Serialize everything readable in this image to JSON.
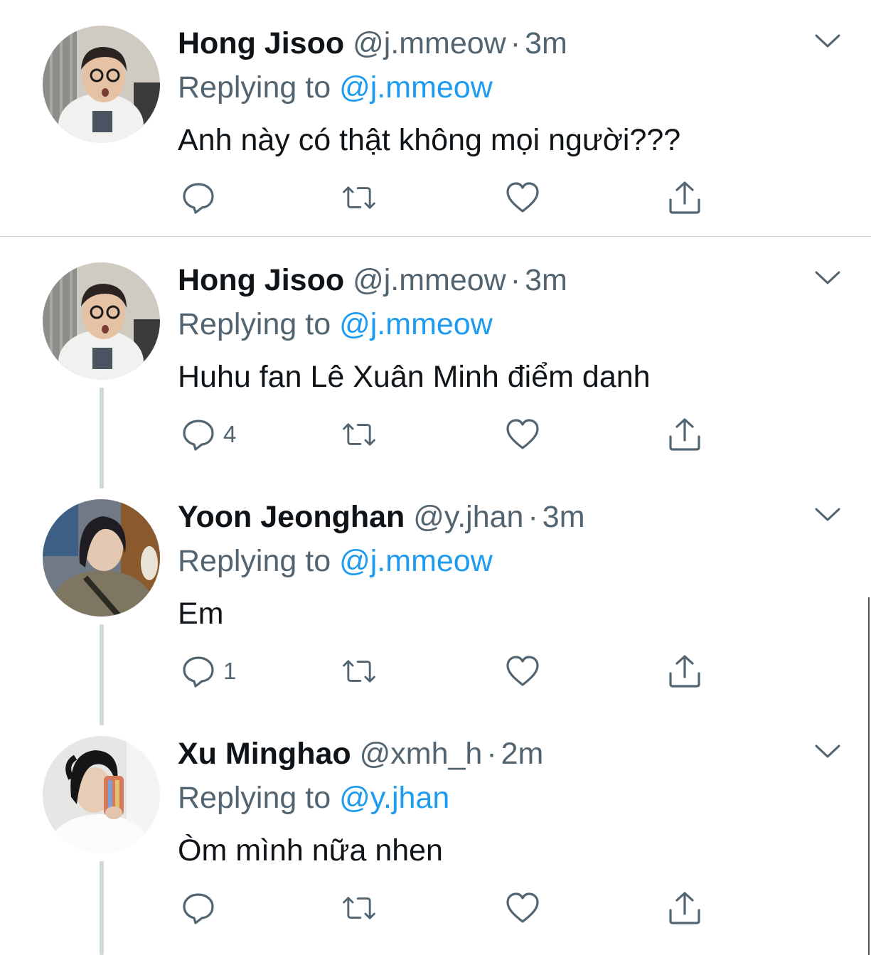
{
  "tweets": [
    {
      "display_name": "Hong Jisoo",
      "handle": "@j.mmeow",
      "separator": "·",
      "time": "3m",
      "replying_label": "Replying to",
      "replying_handle": "@j.mmeow",
      "text": "Anh này có thật không mọi người???",
      "reply_count": "",
      "avatar": "avatar-hong-jisoo"
    },
    {
      "display_name": "Hong Jisoo",
      "handle": "@j.mmeow",
      "separator": "·",
      "time": "3m",
      "replying_label": "Replying to",
      "replying_handle": "@j.mmeow",
      "text": "Huhu fan Lê Xuân Minh điểm danh",
      "reply_count": "4",
      "avatar": "avatar-hong-jisoo"
    },
    {
      "display_name": "Yoon Jeonghan",
      "handle": "@y.jhan",
      "separator": "·",
      "time": "3m",
      "replying_label": "Replying to",
      "replying_handle": "@j.mmeow",
      "text": "Em",
      "reply_count": "1",
      "avatar": "avatar-yoon-jeonghan"
    },
    {
      "display_name": "Xu Minghao",
      "handle": "@xmh_h",
      "separator": "·",
      "time": "2m",
      "replying_label": "Replying to",
      "replying_handle": "@y.jhan",
      "text": "Òm mình nữa nhen",
      "reply_count": "",
      "avatar": "avatar-xu-minghao"
    }
  ],
  "icons": {
    "reply": "speech-bubble-icon",
    "retweet": "retweet-arrows-icon",
    "like": "heart-icon",
    "share": "share-upload-icon",
    "more": "chevron-down-icon"
  },
  "colors": {
    "text_primary": "#0f1419",
    "text_secondary": "#536471",
    "link": "#1d9bf0",
    "icon": "#536471",
    "thread_line": "#cfd9de",
    "divider": "#cfd9de"
  }
}
